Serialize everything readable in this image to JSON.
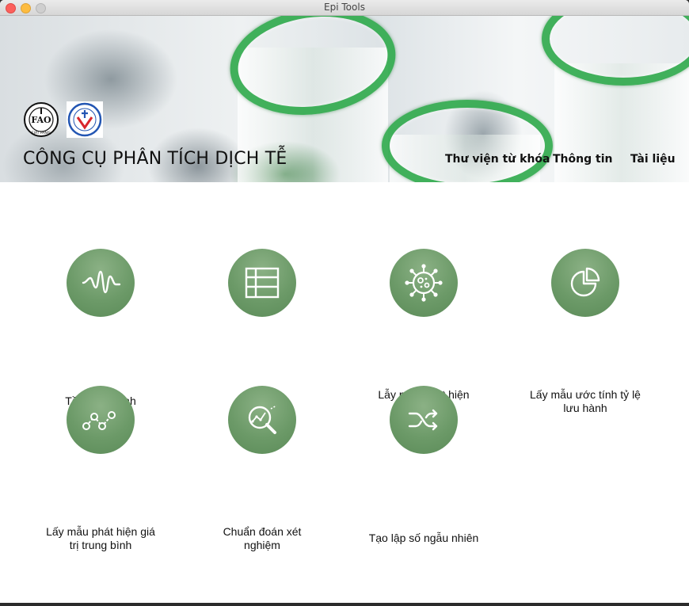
{
  "window": {
    "title": "Epi Tools"
  },
  "header": {
    "app_title": "CÔNG CỤ PHÂN TÍCH DỊCH TỄ",
    "nav": [
      {
        "label": "Thư viện từ khóa"
      },
      {
        "label": "Thông tin"
      },
      {
        "label": "Tài liệu"
      }
    ],
    "logos": [
      {
        "name": "fao-logo",
        "text": "FIAT PANIS"
      },
      {
        "name": "department-animal-health-logo"
      }
    ]
  },
  "tools": [
    {
      "label": "Tần suất bệnh",
      "icon": "waveform-icon"
    },
    {
      "label": "Bảng 2x2",
      "icon": "table-grid-icon"
    },
    {
      "label": "Lẫy mẫu phát hiện bệnh",
      "icon": "virus-icon"
    },
    {
      "label": "Lấy mẫu ước tính tỷ lệ lưu hành",
      "icon": "pie-chart-icon"
    },
    {
      "label": "Lấy mẫu phát hiện giá trị trung bình",
      "icon": "trend-line-icon"
    },
    {
      "label": "Chuẩn đoán xét nghiệm",
      "icon": "magnifier-chart-icon"
    },
    {
      "label": "Tạo lập số ngẫu nhiên",
      "icon": "shuffle-icon"
    }
  ],
  "colors": {
    "icon_circle": "#6c9a68",
    "icon_stroke": "#ffffff",
    "tube_green": "#2ea84a"
  }
}
